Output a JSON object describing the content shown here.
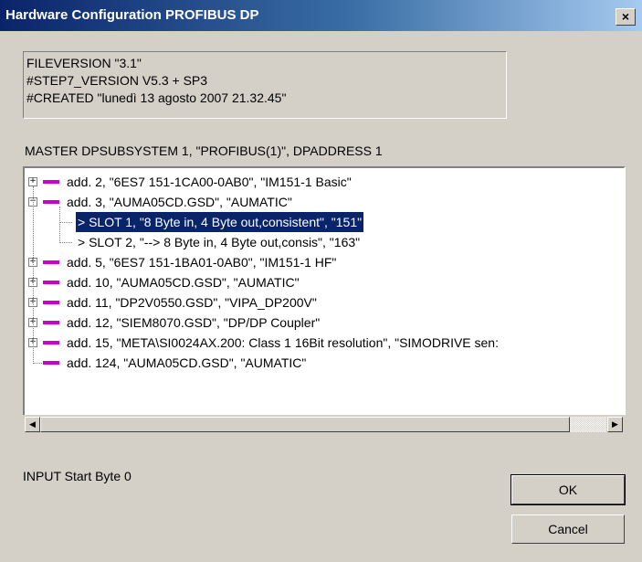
{
  "window": {
    "title": "Hardware Configuration PROFIBUS DP",
    "close_label": "×"
  },
  "info": {
    "lines": [
      "FILEVERSION \"3.1\"",
      "#STEP7_VERSION V5.3 + SP3",
      "#CREATED \"lunedì 13 agosto 2007   21.32.45\""
    ]
  },
  "master_label": "MASTER DPSUBSYSTEM 1, \"PROFIBUS(1)\", DPADDRESS 1",
  "tree": {
    "nodes": [
      {
        "text": "add. 2, \"6ES7 151-1CA00-0AB0\", \"IM151-1 Basic\"",
        "level": 0,
        "expander": "+",
        "selected": false
      },
      {
        "text": "add. 3, \"AUMA05CD.GSD\", \"AUMATIC\"",
        "level": 0,
        "expander": "−",
        "selected": false
      },
      {
        "text": "> SLOT 1, \"8 Byte in, 4 Byte out,consistent\", \"151\"",
        "level": 1,
        "expander": "",
        "selected": true
      },
      {
        "text": "> SLOT 2, \"--> 8 Byte in, 4 Byte out,consis\", \"163\"",
        "level": 1,
        "expander": "",
        "selected": false
      },
      {
        "text": "add. 5, \"6ES7 151-1BA01-0AB0\", \"IM151-1 HF\"",
        "level": 0,
        "expander": "+",
        "selected": false
      },
      {
        "text": "add. 10, \"AUMA05CD.GSD\", \"AUMATIC\"",
        "level": 0,
        "expander": "+",
        "selected": false
      },
      {
        "text": "add. 11, \"DP2V0550.GSD\", \"VIPA_DP200V\"",
        "level": 0,
        "expander": "+",
        "selected": false
      },
      {
        "text": "add. 12, \"SIEM8070.GSD\", \"DP/DP Coupler\"",
        "level": 0,
        "expander": "+",
        "selected": false
      },
      {
        "text": "add. 15, \"META\\SI0024AX.200: Class 1  16Bit resolution\", \"SIMODRIVE sen:",
        "level": 0,
        "expander": "+",
        "selected": false
      },
      {
        "text": "add. 124, \"AUMA05CD.GSD\", \"AUMATIC\"",
        "level": 0,
        "expander": "",
        "selected": false
      }
    ],
    "scroll_left_icon": "arrow-left-icon",
    "scroll_right_icon": "arrow-right-icon"
  },
  "input_label": "INPUT   Start Byte  0",
  "buttons": {
    "ok": "OK",
    "cancel": "Cancel"
  },
  "colors": {
    "title_bar": "#0a246a",
    "face": "#d4d0c8",
    "device_marker": "#cc00cc",
    "selection": "#0a246a"
  }
}
